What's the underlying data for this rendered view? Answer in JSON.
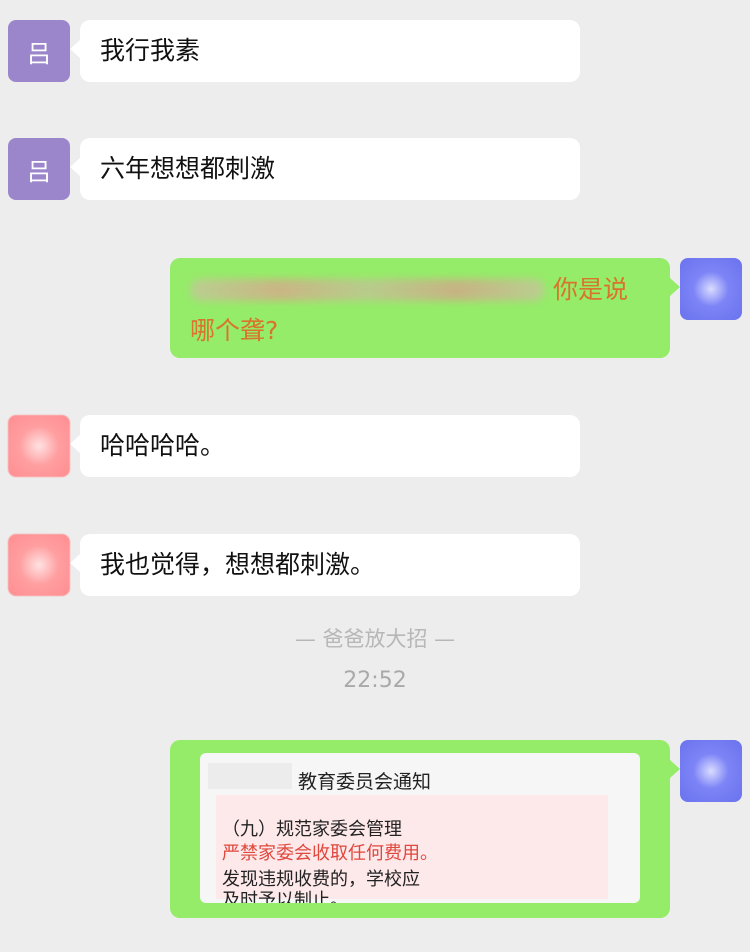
{
  "messages": [
    {
      "side": "left",
      "avatar_label": "吕",
      "avatar_style": "purple",
      "text": "我行我素"
    },
    {
      "side": "left",
      "avatar_label": "吕",
      "avatar_style": "purple",
      "text": "六年想想都刺激"
    },
    {
      "side": "right",
      "avatar_style": "blue",
      "text_orange_1": "你是说",
      "text_orange_2": "哪个聋?"
    },
    {
      "side": "left",
      "avatar_style": "pink",
      "text": "哈哈哈哈。"
    },
    {
      "side": "left",
      "avatar_style": "pink",
      "text": "我也觉得，想想都刺激。"
    }
  ],
  "system": {
    "notice": "— 爸爸放大招 —",
    "time": "22:52"
  },
  "shared_doc": {
    "title": "教育委员会通知",
    "line1": "（九）规范家委会管理",
    "line2": "严禁家委会收取任何费用。",
    "line3": "发现违规收费的，学校应",
    "line4": "及时予以制止。"
  },
  "colors": {
    "background": "#ededed",
    "green_bubble": "#95ec69",
    "orange_text": "#d9742b",
    "red_text": "#e0473d"
  }
}
